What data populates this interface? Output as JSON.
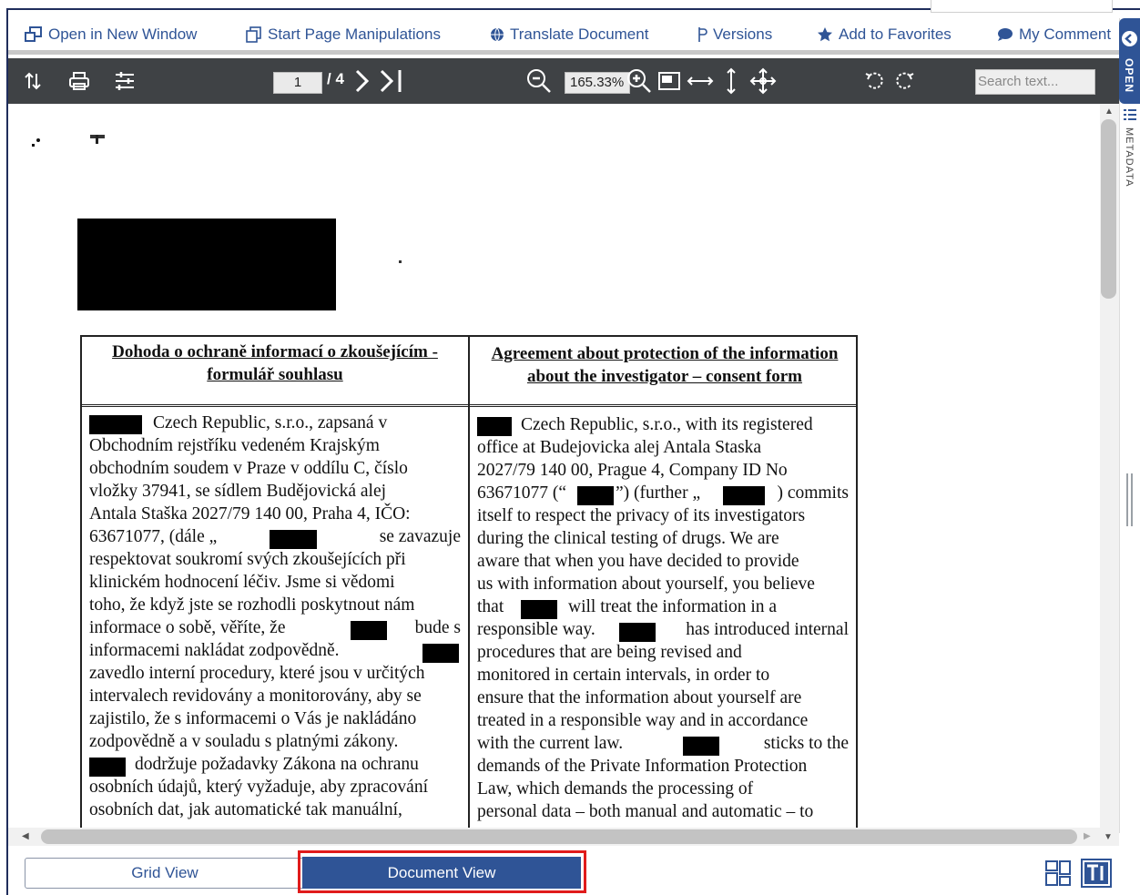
{
  "action_bar": {
    "items": [
      {
        "label": "Open in New Window",
        "icon": "new-window-icon"
      },
      {
        "label": "Start Page Manipulations",
        "icon": "page-manipulation-icon"
      },
      {
        "label": "Translate Document",
        "icon": "globe-icon"
      },
      {
        "label": "Versions",
        "icon": "versions-icon"
      },
      {
        "label": "Add to Favorites",
        "icon": "star-icon"
      },
      {
        "label": "My Comment",
        "icon": "comment-icon"
      }
    ]
  },
  "toolbar": {
    "current_page": "1",
    "total_pages": "/ 4",
    "zoom": "165.33%",
    "search_placeholder": "Search text..."
  },
  "side_panel": {
    "open_label": "OPEN",
    "metadata_label": "METADATA"
  },
  "document": {
    "left_header": "Dohoda o ochraně informací o zkoušejícím - formulář souhlasu",
    "right_header": "Agreement about protection of the information about the investigator – consent form",
    "left_body": [
      "Czech Republic, s.r.o., zapsaná v",
      "Obchodním rejstříku vedeném Krajským",
      "obchodním soudem v Praze v oddílu C, číslo",
      "vložky 37941, se sídlem Budějovická alej",
      "Antala Staška 2027/79 140 00, Praha 4, IČO:",
      "63671077, (dále „",
      "respektovat soukromí svých zkoušejících při",
      "klinickém hodnocení léčiv. Jsme si vědomi",
      "toho, že když jste se rozhodli poskytnout nám",
      "informace o sobě, věříte, že",
      "informacemi nakládat zodpovědně.",
      "zavedlo interní procedury, které jsou v určitých",
      "intervalech revidovány a monitorovány, aby se",
      "zajistilo, že s informacemi o Vás je nakládáno",
      "zodpovědně a v souladu s platnými zákony.",
      "dodržuje požadavky Zákona na ochranu",
      "osobních údajů, který vyžaduje, aby zpracování",
      "osobních dat, jak automatické tak manuální,"
    ],
    "left_body_fragments": {
      "se_zavazuje": "se zavazuje",
      "bude_s": "bude s"
    },
    "right_body": [
      "Czech Republic, s.r.o., with its registered",
      "office at Budejovicka alej Antala Staska",
      "2027/79 140 00, Prague 4, Company ID No",
      "63671077 (“",
      "itself to respect the privacy of its investigators",
      "during the clinical testing of drugs. We are",
      "aware that when you have decided to provide",
      "us with information about yourself, you believe",
      "that",
      "responsible way.",
      "procedures that are being revised and",
      "monitored in certain intervals, in order to",
      "ensure that the information about yourself are",
      "treated in a responsible way and in accordance",
      "with the current law.",
      "demands of the Private Information Protection",
      "Law, which demands the processing of",
      "personal data – both manual and automatic – to"
    ],
    "right_body_fragments": {
      "further": "”) (further „",
      "commits": ") commits",
      "will_treat": "will treat the information in a",
      "has_introduced": "has introduced internal",
      "sticks_to": "sticks to the"
    }
  },
  "bottom_bar": {
    "grid_view_label": "Grid View",
    "document_view_label": "Document View"
  },
  "colors": {
    "accent": "#2f5496",
    "toolbar_bg": "#3f4245",
    "highlight": "#e01b1b"
  }
}
